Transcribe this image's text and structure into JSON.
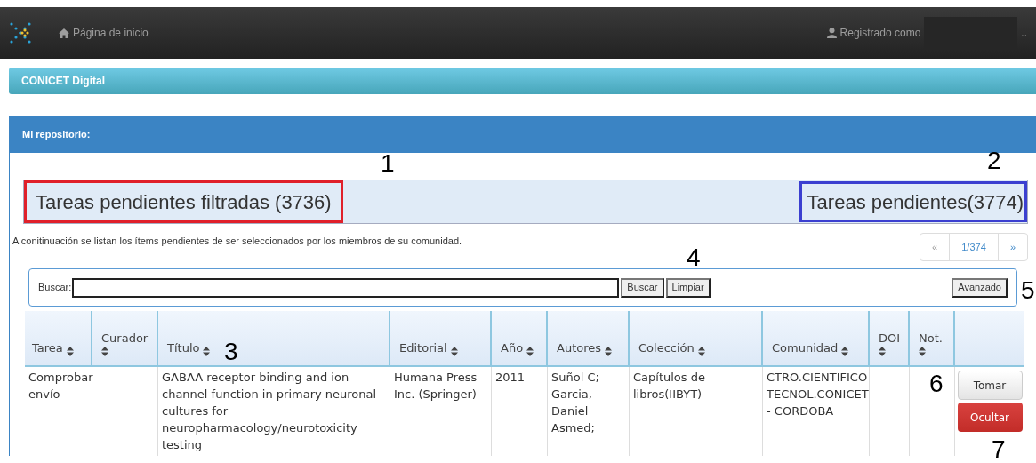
{
  "navbar": {
    "home_link": "Página de inicio",
    "user_label": "Registrado como",
    "user_suffix": ".."
  },
  "breadcrumb": "CONICET Digital",
  "panel": {
    "title": "Mi repositorio:",
    "filtered_heading": "Tareas pendientes filtradas (3736)",
    "total_heading": "Tareas pendientes(3774)",
    "description": "A conitinuación se listan los ítems pendientes de ser seleccionados por los miembros de su comunidad.",
    "pagination": {
      "prev": "«",
      "page": "1/374",
      "next": "»"
    },
    "search": {
      "label": "Buscar:",
      "buttons": [
        "Buscar",
        "Limpiar"
      ],
      "advanced": "Avanzado"
    },
    "table": {
      "columns": [
        {
          "label": "Tarea",
          "sortable": true
        },
        {
          "label": "Curador",
          "sortable": true
        },
        {
          "label": "Título",
          "sortable": true
        },
        {
          "label": "Editorial",
          "sortable": true
        },
        {
          "label": "Año",
          "sortable": true
        },
        {
          "label": "Autores",
          "sortable": true
        },
        {
          "label": "Colección",
          "sortable": true
        },
        {
          "label": "Comunidad",
          "sortable": true
        },
        {
          "label": "DOI",
          "sortable": true
        },
        {
          "label": "Not.",
          "sortable": true
        },
        {
          "sortable": false
        }
      ],
      "rows": [
        {
          "tarea": "Comprobar envío",
          "titulo": "GABAA receptor binding and ion channel function in primary neuronal cultures for neuropharmacology/neurotoxicity testing",
          "editorial": "Humana Press Inc. (Springer)",
          "anio": "2011",
          "autores": "Suñol C; Garcia, Daniel Asmed;",
          "coleccion": "Capítulos de libros(IIBYT)",
          "comunidad": "CTRO.CIENTIFICO TECNOL.CONICET - CORDOBA",
          "actions": [
            {
              "label": "Tomar",
              "kind": "default"
            },
            {
              "label": "Ocultar",
              "kind": "danger"
            }
          ]
        }
      ]
    }
  },
  "annotations": [
    "1",
    "2",
    "3",
    "4",
    "5",
    "6",
    "7"
  ]
}
